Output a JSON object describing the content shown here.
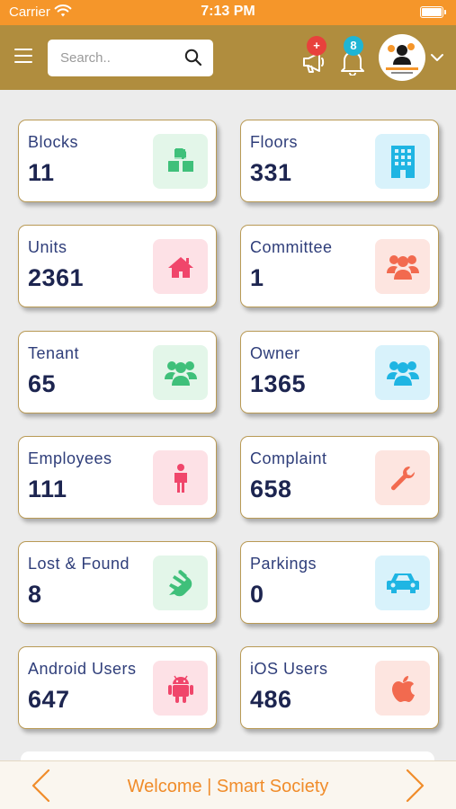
{
  "status_bar": {
    "carrier": "Carrier",
    "time": "7:13 PM"
  },
  "header": {
    "search_placeholder": "Search..",
    "announcement_badge": "+",
    "notification_count": "8"
  },
  "cards": [
    {
      "label": "Blocks",
      "value": "11",
      "icon": "cubes-icon",
      "bg": "#e3f6e9",
      "color": "#3fc07a"
    },
    {
      "label": "Floors",
      "value": "331",
      "icon": "building-icon",
      "bg": "#d8f2fb",
      "color": "#1fb5e3"
    },
    {
      "label": "Units",
      "value": "2361",
      "icon": "home-icon",
      "bg": "#fde1e6",
      "color": "#f0466b"
    },
    {
      "label": "Committee",
      "value": "1",
      "icon": "users-icon",
      "bg": "#fde5e0",
      "color": "#f26a4f"
    },
    {
      "label": "Tenant",
      "value": "65",
      "icon": "users-icon",
      "bg": "#e3f6e9",
      "color": "#3fc07a"
    },
    {
      "label": "Owner",
      "value": "1365",
      "icon": "users-icon",
      "bg": "#d8f2fb",
      "color": "#1fb5e3"
    },
    {
      "label": "Employees",
      "value": "111",
      "icon": "person-icon",
      "bg": "#fde1e6",
      "color": "#f0466b"
    },
    {
      "label": "Complaint",
      "value": "658",
      "icon": "wrench-icon",
      "bg": "#fde5e0",
      "color": "#f26a4f"
    },
    {
      "label": "Lost & Found",
      "value": "8",
      "icon": "hands-icon",
      "bg": "#e3f6e9",
      "color": "#3fc07a"
    },
    {
      "label": "Parkings",
      "value": "0",
      "icon": "car-icon",
      "bg": "#d8f2fb",
      "color": "#1fb5e3"
    },
    {
      "label": "Android Users",
      "value": "647",
      "icon": "android-icon",
      "bg": "#fde1e6",
      "color": "#f0466b"
    },
    {
      "label": "iOS Users",
      "value": "486",
      "icon": "apple-icon",
      "bg": "#fde5e0",
      "color": "#f26a4f"
    }
  ],
  "footer": {
    "welcome_text": "Welcome | Smart Society"
  },
  "colors": {
    "status_bar": "#f5962a",
    "nav_bar": "#b08d3e",
    "card_border": "#b99a55",
    "footer_text": "#f08c2a"
  }
}
